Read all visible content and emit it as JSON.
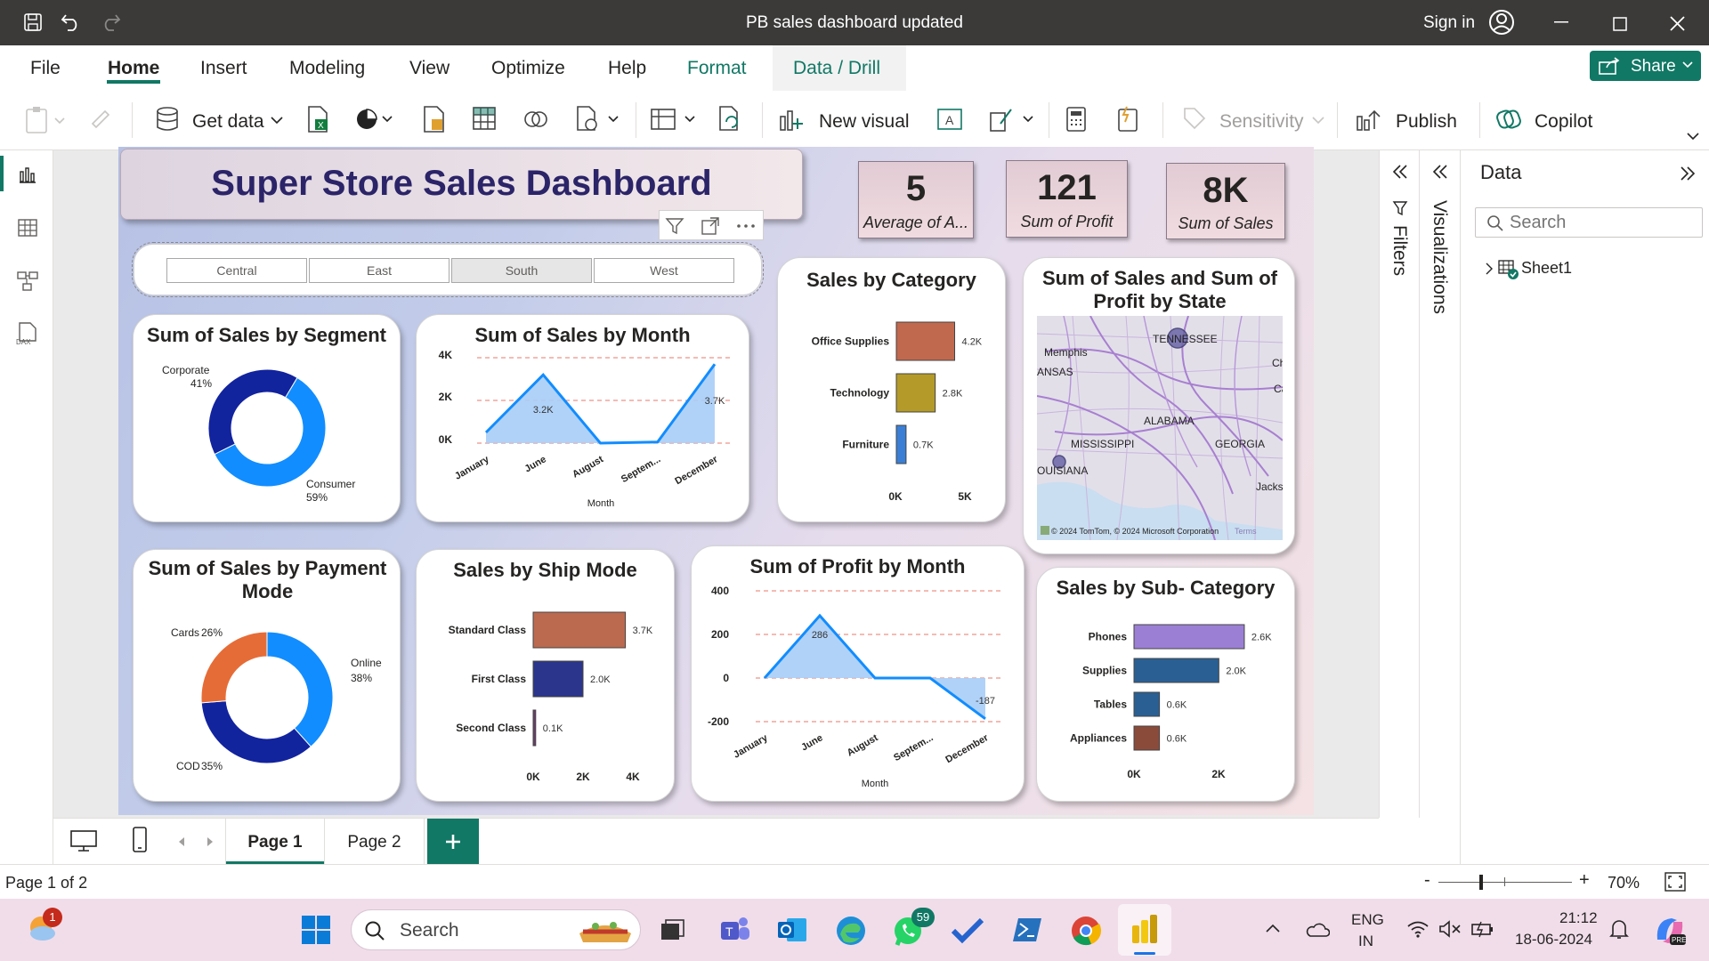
{
  "window": {
    "title": "PB sales dashboard updated",
    "sign_in": "Sign in"
  },
  "menu": {
    "file": "File",
    "home": "Home",
    "insert": "Insert",
    "modeling": "Modeling",
    "view": "View",
    "optimize": "Optimize",
    "help": "Help",
    "format": "Format",
    "data_drill": "Data / Drill",
    "share": "Share"
  },
  "ribbon": {
    "get_data": "Get data",
    "new_visual": "New visual",
    "sensitivity": "Sensitivity",
    "publish": "Publish",
    "copilot": "Copilot"
  },
  "dashboard": {
    "title": "Super Store Sales Dashboard",
    "kpis": [
      {
        "value": "5",
        "label": "Average of A..."
      },
      {
        "value": "121",
        "label": "Sum of Profit"
      },
      {
        "value": "8K",
        "label": "Sum of Sales"
      }
    ],
    "slicer": [
      "Central",
      "East",
      "South",
      "West"
    ],
    "slicer_selected": "South"
  },
  "chart_data": [
    {
      "id": "segment",
      "type": "pie",
      "title": "Sum of Sales by Segment",
      "slices": [
        {
          "label": "Consumer",
          "value": 59,
          "pct": "59%",
          "color": "#118dff"
        },
        {
          "label": "Corporate",
          "value": 41,
          "pct": "41%",
          "color": "#12239e"
        }
      ]
    },
    {
      "id": "sales_month",
      "type": "area",
      "title": "Sum of Sales by Month",
      "xlabel": "Month",
      "categories": [
        "January",
        "June",
        "August",
        "Septem...",
        "December"
      ],
      "values": [
        0.5,
        3.2,
        0.0,
        0.05,
        3.7
      ],
      "labels": [
        "",
        "3.2K",
        "",
        "",
        "3.7K"
      ],
      "yticks": [
        "0K",
        "2K",
        "4K"
      ],
      "ylim": [
        0,
        4
      ]
    },
    {
      "id": "category",
      "type": "bar",
      "title": "Sales by Category",
      "categories": [
        "Office Supplies",
        "Technology",
        "Furniture"
      ],
      "values": [
        4.2,
        2.8,
        0.7
      ],
      "labels": [
        "4.2K",
        "2.8K",
        "0.7K"
      ],
      "colors": [
        "#c0694e",
        "#b49a28",
        "#3a7fd5"
      ],
      "xticks": [
        "0K",
        "5K"
      ],
      "xlim": [
        0,
        5
      ]
    },
    {
      "id": "payment",
      "type": "pie",
      "title": "Sum of Sales by Payment Mode",
      "slices": [
        {
          "label": "Online",
          "value": 38,
          "pct": "38%",
          "color": "#118dff"
        },
        {
          "label": "COD",
          "value": 35,
          "pct": "35%",
          "color": "#12239e"
        },
        {
          "label": "Cards",
          "value": 26,
          "pct": "26%",
          "color": "#e66c37"
        }
      ]
    },
    {
      "id": "shipmode",
      "type": "bar",
      "title": "Sales by Ship Mode",
      "categories": [
        "Standard Class",
        "First Class",
        "Second Class"
      ],
      "values": [
        3.7,
        2.0,
        0.1
      ],
      "labels": [
        "3.7K",
        "2.0K",
        "0.1K"
      ],
      "colors": [
        "#bb6a4f",
        "#2b358c",
        "#6b3b6b"
      ],
      "xticks": [
        "0K",
        "2K",
        "4K"
      ],
      "xlim": [
        0,
        4
      ]
    },
    {
      "id": "profit_month",
      "type": "area",
      "title": "Sum of Profit by Month",
      "xlabel": "Month",
      "categories": [
        "January",
        "June",
        "August",
        "Septem...",
        "December"
      ],
      "values": [
        0,
        286,
        0,
        0,
        -187
      ],
      "labels": [
        "",
        "286",
        "",
        "",
        "-187"
      ],
      "yticks": [
        "-200",
        "0",
        "200",
        "400"
      ],
      "ylim": [
        -200,
        400
      ]
    },
    {
      "id": "subcategory",
      "type": "bar",
      "title": "Sales by Sub- Category",
      "categories": [
        "Phones",
        "Supplies",
        "Tables",
        "Appliances"
      ],
      "values": [
        2.6,
        2.0,
        0.6,
        0.6
      ],
      "labels": [
        "2.6K",
        "2.0K",
        "0.6K",
        "0.6K"
      ],
      "colors": [
        "#9b7fd4",
        "#2a5f93",
        "#2a5f93",
        "#8a4b3b"
      ],
      "xticks": [
        "0K",
        "2K"
      ],
      "xlim": [
        0,
        3
      ]
    }
  ],
  "map": {
    "title": "Sum of Sales and Sum of Profit by State",
    "labels": [
      "Memphis",
      "TENNESSEE",
      "ANSAS",
      "ALABAMA",
      "MISSISSIPPI",
      "GEORGIA",
      "OUISIANA",
      "Jackso",
      "Ch",
      "Ca"
    ],
    "attribution": "© 2024 TomTom, © 2024 Microsoft Corporation",
    "terms": "Terms"
  },
  "panes": {
    "filters": "Filters",
    "visualizations": "Visualizations",
    "data_title": "Data",
    "search_placeholder": "Search",
    "table": "Sheet1"
  },
  "pages": {
    "tabs": [
      "Page 1",
      "Page 2"
    ],
    "active": "Page 1",
    "status": "Page 1 of 2",
    "zoom": "70%"
  },
  "taskbar": {
    "search": "Search",
    "lang1": "ENG",
    "lang2": "IN",
    "time": "21:12",
    "date": "18-06-2024",
    "badge_widget": "1",
    "badge_whatsapp": "59"
  }
}
